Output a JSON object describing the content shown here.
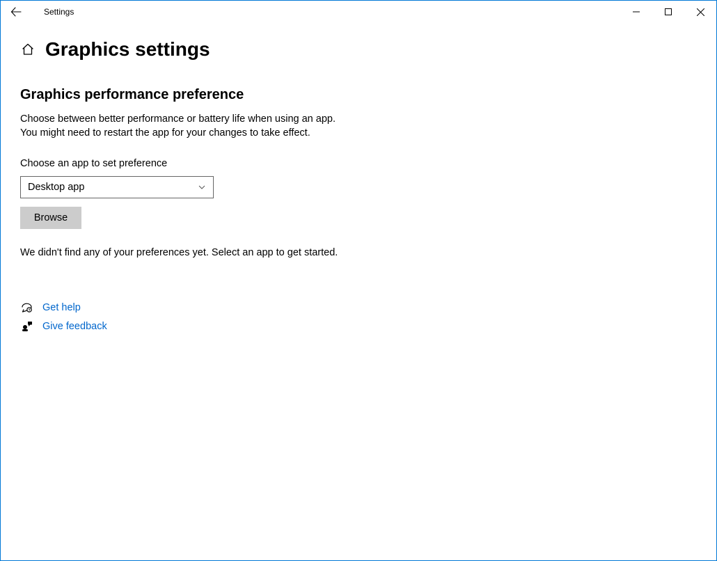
{
  "titlebar": {
    "app_name": "Settings"
  },
  "page": {
    "title": "Graphics settings",
    "section_title": "Graphics performance preference",
    "description_line1": "Choose between better performance or battery life when using an app.",
    "description_line2": "You might need to restart the app for your changes to take effect.",
    "dropdown_label": "Choose an app to set preference",
    "dropdown_value": "Desktop app",
    "browse_label": "Browse",
    "empty_message": "We didn't find any of your preferences yet. Select an app to get started."
  },
  "links": {
    "help": "Get help",
    "feedback": "Give feedback"
  }
}
